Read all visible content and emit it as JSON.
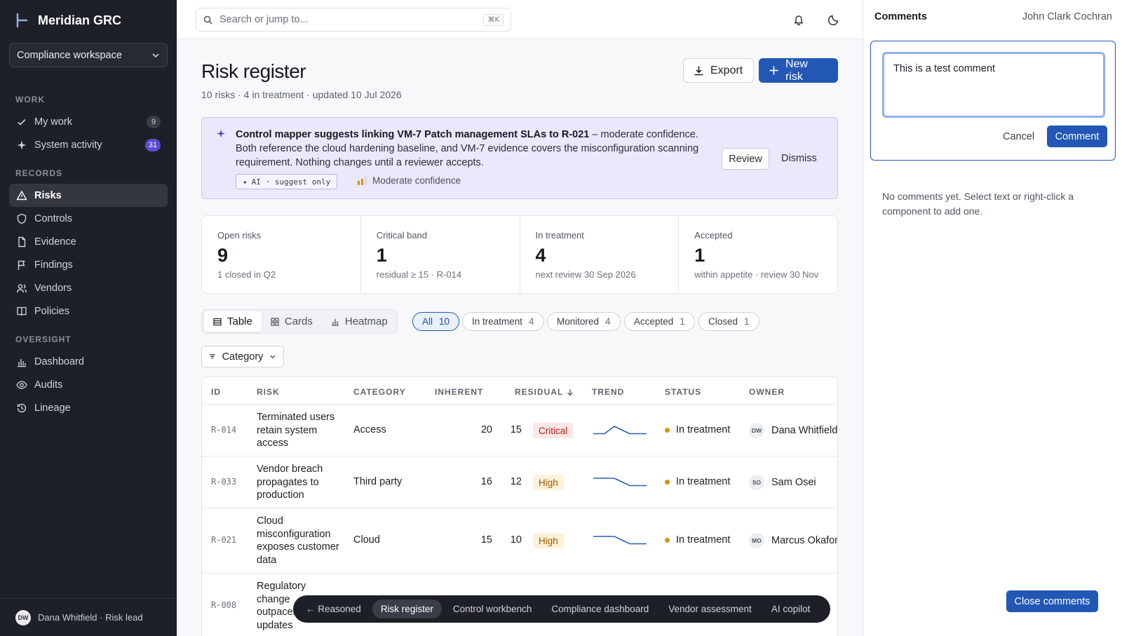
{
  "app": {
    "name": "Meridian GRC",
    "workspace": "Compliance workspace"
  },
  "sidebar": {
    "sections": {
      "work": "WORK",
      "records": "RECORDS",
      "oversight": "OVERSIGHT"
    },
    "items": [
      {
        "label": "My work",
        "count": "9"
      },
      {
        "label": "System activity",
        "count": "31"
      },
      {
        "label": "Risks"
      },
      {
        "label": "Controls"
      },
      {
        "label": "Evidence"
      },
      {
        "label": "Findings"
      },
      {
        "label": "Vendors"
      },
      {
        "label": "Policies"
      },
      {
        "label": "Dashboard"
      },
      {
        "label": "Audits"
      },
      {
        "label": "Lineage"
      }
    ],
    "user": {
      "initials": "DW",
      "label": "Dana Whitfield · Risk lead"
    }
  },
  "topbar": {
    "search_placeholder": "Search or jump to...",
    "shortcut": "⌘K"
  },
  "page": {
    "title": "Risk register",
    "subtitle": "10 risks · 4 in treatment · updated 10 Jul 2026",
    "export_label": "Export",
    "new_label": "New risk"
  },
  "ai_banner": {
    "headline": "Control mapper suggests linking VM-7 Patch management SLAs to R-021",
    "headline_suffix": " – moderate confidence.",
    "body": "Both reference the cloud hardening baseline, and VM-7 evidence covers the misconfiguration scanning requirement. Nothing changes until a reviewer accepts.",
    "chip": "AI · suggest only",
    "confidence": "Moderate confidence",
    "review_label": "Review",
    "dismiss_label": "Dismiss"
  },
  "stats": [
    {
      "label": "Open risks",
      "value": "9",
      "sub": "1 closed in Q2"
    },
    {
      "label": "Critical band",
      "value": "1",
      "sub": "residual ≥ 15 · R-014"
    },
    {
      "label": "In treatment",
      "value": "4",
      "sub": "next review 30 Sep 2026"
    },
    {
      "label": "Accepted",
      "value": "1",
      "sub": "within appetite · review 30 Nov"
    }
  ],
  "view_tabs": [
    "Table",
    "Cards",
    "Heatmap"
  ],
  "filters": [
    {
      "label": "All",
      "count": "10"
    },
    {
      "label": "In treatment",
      "count": "4"
    },
    {
      "label": "Monitored",
      "count": "4"
    },
    {
      "label": "Accepted",
      "count": "1"
    },
    {
      "label": "Closed",
      "count": "1"
    }
  ],
  "category_filter": "Category",
  "table": {
    "headers": [
      "ID",
      "RISK",
      "CATEGORY",
      "INHERENT",
      "RESIDUAL",
      "TREND",
      "STATUS",
      "OWNER"
    ],
    "rows": [
      {
        "id": "R-014",
        "risk": "Terminated users retain system access",
        "category": "Access",
        "inherent": "20",
        "residual": "15",
        "band": "Critical",
        "status": "In treatment",
        "owner_initials": "DW",
        "owner": "Dana Whitfield",
        "trend": [
          3,
          3,
          10,
          3,
          3
        ]
      },
      {
        "id": "R-033",
        "risk": "Vendor breach propagates to production",
        "category": "Third party",
        "inherent": "16",
        "residual": "12",
        "band": "High",
        "status": "In treatment",
        "owner_initials": "SO",
        "owner": "Sam Osei",
        "trend": [
          10,
          10,
          10,
          3,
          3
        ]
      },
      {
        "id": "R-021",
        "risk": "Cloud misconfiguration exposes customer data",
        "category": "Cloud",
        "inherent": "15",
        "residual": "10",
        "band": "High",
        "status": "In treatment",
        "owner_initials": "MO",
        "owner": "Marcus Okafor",
        "trend": [
          10,
          10,
          10,
          3,
          3
        ]
      },
      {
        "id": "R-008",
        "risk": "Regulatory change outpaces updates",
        "category": "",
        "inherent": "",
        "residual": "",
        "band": "",
        "status": "",
        "owner_initials": "",
        "owner": "",
        "trend": []
      }
    ]
  },
  "footer_nav": [
    "← Reasoned",
    "Risk register",
    "Control workbench",
    "Compliance dashboard",
    "Vendor assessment",
    "AI copilot"
  ],
  "comments": {
    "title": "Comments",
    "user": "John Clark Cochran",
    "draft": "This is a test comment",
    "cancel_label": "Cancel",
    "submit_label": "Comment",
    "empty": "No comments yet. Select text or right-click a component to add one.",
    "close_label": "Close comments"
  },
  "colors": {
    "accent": "#2257b5",
    "sidebar": "#1d2026",
    "ai_bg": "#ece8fb",
    "critical": "#b42318",
    "high": "#9a5a00",
    "trend": "#2a5db8"
  }
}
